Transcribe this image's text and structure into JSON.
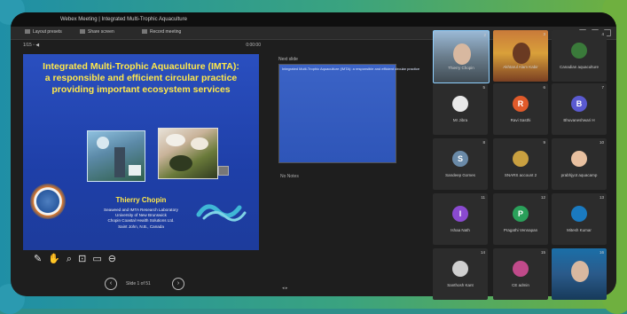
{
  "window": {
    "title": "Webex Meeting | Integrated Multi-Trophic Aquaculture"
  },
  "toolbar": {
    "items": [
      "Layout presets",
      "Share screen",
      "Record meeting"
    ]
  },
  "presentation": {
    "header_left": "1/15 ▫ ◀",
    "header_right": "0:00:00",
    "slide": {
      "title_line1": "Integrated Multi-Trophic Aquaculture (IMTA):",
      "title_line2": "a responsible and efficient circular practice",
      "title_line3": "providing important ecosystem services",
      "presenter": "Thierry Chopin",
      "affiliation_line1": "Seaweed and IMTA Research Laboratory",
      "affiliation_line2": "University of New Brunswick",
      "affiliation_line3": "Chopin Coastal Health Solutions Ltd.",
      "affiliation_line4": "Saint John, N.B., Canada"
    },
    "pager_text": "Slide 1 of 51"
  },
  "side_panel": {
    "title": "Next slide",
    "caption": "Integrated Multi-Trophic Aquaculture (IMTA): a responsible and efficient circular practice",
    "notes_label": "No Notes",
    "footer_icons": "◂ ▸"
  },
  "participants": [
    {
      "num": "2",
      "name": "Thierry Chopin",
      "initial": "",
      "color": "#6a7d8c",
      "kind": "video1"
    },
    {
      "num": "3",
      "name": "Akhtarul Alam Kabir",
      "initial": "",
      "color": "#c97a3a",
      "kind": "video2"
    },
    {
      "num": "4",
      "name": "Canadian aquaculture",
      "initial": "",
      "color": "#3a7a3a",
      "kind": "avatar"
    },
    {
      "num": "5",
      "name": "Mr Jibra",
      "initial": "",
      "color": "#e8e8e8",
      "kind": "avatar"
    },
    {
      "num": "6",
      "name": "Ravi Sasthi",
      "initial": "R",
      "color": "#e05a2a",
      "kind": "avatar"
    },
    {
      "num": "7",
      "name": "Bhuvaneshwari H",
      "initial": "B",
      "color": "#5a5ad0",
      "kind": "avatar"
    },
    {
      "num": "8",
      "name": "Sandeep Gomes",
      "initial": "S",
      "color": "#6a8aa8",
      "kind": "avatar"
    },
    {
      "num": "9",
      "name": "SNARS account 2",
      "initial": "",
      "color": "#c9a040",
      "kind": "avatar"
    },
    {
      "num": "10",
      "name": "prabhjyot aquacamp",
      "initial": "",
      "color": "#e8c0a0",
      "kind": "avatar"
    },
    {
      "num": "11",
      "name": "Ishaa Nath",
      "initial": "I",
      "color": "#8a4ad0",
      "kind": "avatar"
    },
    {
      "num": "12",
      "name": "Pragathi Vennapan",
      "initial": "P",
      "color": "#2aa05a",
      "kind": "avatar"
    },
    {
      "num": "13",
      "name": "Mitesh Kumar",
      "initial": "",
      "color": "#1a7ac0",
      "kind": "avatar"
    },
    {
      "num": "14",
      "name": "Santhosh Kant",
      "initial": "",
      "color": "#d0d0d0",
      "kind": "avatar"
    },
    {
      "num": "15",
      "name": "CE admin",
      "initial": "",
      "color": "#c04a8a",
      "kind": "avatar"
    },
    {
      "num": "16",
      "name": "",
      "initial": "",
      "color": "#1b6fa8",
      "kind": "video3"
    }
  ]
}
